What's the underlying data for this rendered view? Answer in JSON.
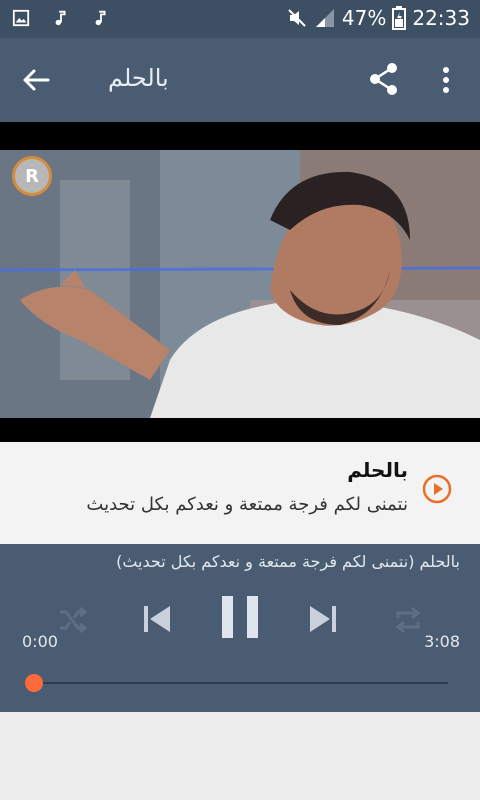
{
  "statusbar": {
    "battery": "47%",
    "time": "22:33",
    "icons": [
      "image-icon",
      "music-note-icon",
      "music-note-icon",
      "mute-icon",
      "signal-icon",
      "battery-icon"
    ]
  },
  "appbar": {
    "title": "بالحلم",
    "icons": [
      "back-arrow-icon",
      "share-icon",
      "more-vert-icon"
    ]
  },
  "video": {
    "logo_text": "R"
  },
  "now_playing_card": {
    "title": "بالحلم",
    "subtitle": "نتمنى لكم فرجة ممتعة و نعدكم بكل تحديث",
    "accent": "#e96f2a"
  },
  "player": {
    "now_playing_line": "بالحلم (نتمنى لكم فرجة ممتعة و نعدكم بكل تحديث)",
    "time_current": "0:00",
    "time_total": "3:08",
    "progress": 0.0,
    "colors": {
      "background": "#4a5c72",
      "accent": "#ff6a3d"
    },
    "controls": [
      "shuffle-icon",
      "previous-icon",
      "pause-icon",
      "next-icon",
      "repeat-icon"
    ]
  }
}
